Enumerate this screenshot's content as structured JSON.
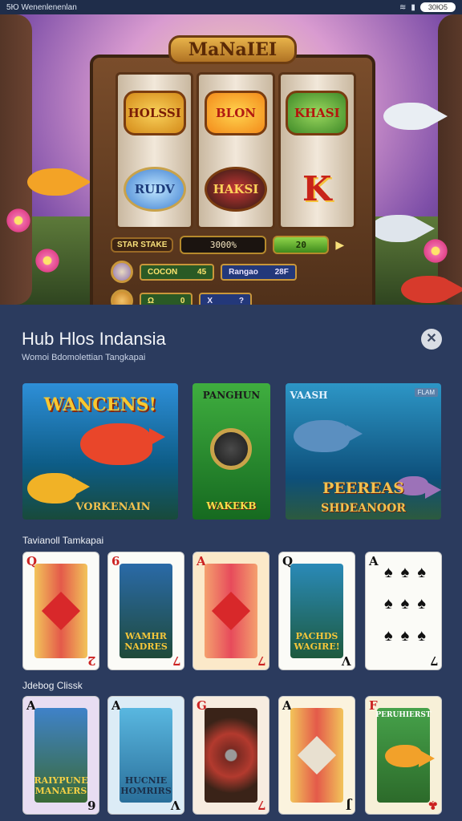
{
  "status_bar": {
    "left_text": "5Ю Wenenlenenlan",
    "right_pill": "30Ю5"
  },
  "hero": {
    "machine_title": "MaNaIEI",
    "reels": [
      [
        "HOLSSI",
        "RUDV"
      ],
      [
        "BLON",
        "HAKSI"
      ],
      [
        "KHASI",
        "K"
      ]
    ],
    "panel": {
      "row1": {
        "label": "STAR STAKE",
        "meter": "3000%",
        "win": "20"
      },
      "row2": {
        "left_label": "COCON",
        "left_value": "45",
        "right_label": "Rangao",
        "right_value": "28F"
      },
      "row3": {
        "left_a": "Ω",
        "left_b": "0",
        "right_a": "X",
        "right_b": "?"
      }
    }
  },
  "sheet": {
    "title": "Hub Hlos Indansia",
    "subtitle": "Womoi Bdomolettian Tangkapai",
    "close_icon": "close-icon",
    "tiles": [
      {
        "top": "WANCENS!",
        "bottom": "VORKENAIN"
      },
      {
        "top": "PANGHUN",
        "bottom": "WAKEKB"
      },
      {
        "top": "VAASH",
        "bottom_line1": "PEEREAS",
        "bottom_line2": "SHDEANOOR",
        "badge": "FLAM"
      }
    ],
    "section1_label": "Tavianoll Tamkapai",
    "section2_label": "Jdebog Clissk",
    "row1_cards": [
      {
        "rank": "Q",
        "suit": "♦",
        "art": "",
        "corner2": "2"
      },
      {
        "rank": "6",
        "suit": "♥",
        "art": "WAMHR NADRES",
        "corner2": "7"
      },
      {
        "rank": "A",
        "suit": "♥",
        "art": "",
        "corner2": "7"
      },
      {
        "rank": "Q",
        "suit": "♠",
        "art": "PACHDS WAGIRE!",
        "corner2": "V"
      },
      {
        "rank": "A",
        "suit": "♠",
        "art": "",
        "corner2": "7"
      }
    ],
    "row2_cards": [
      {
        "rank": "A",
        "suit": "♣",
        "art": "RAIYPUNE MANAERS",
        "corner2": "6"
      },
      {
        "rank": "A",
        "suit": "♣",
        "art": "HUCNIE HOMRIRS",
        "corner2": "V"
      },
      {
        "rank": "G",
        "suit": "♥",
        "art": "",
        "corner2": "7"
      },
      {
        "rank": "A",
        "suit": "♣",
        "art": "",
        "corner2": "J"
      },
      {
        "rank": "F",
        "suit": "♥",
        "art": "PERUHIERST",
        "corner2": "♣"
      }
    ]
  }
}
